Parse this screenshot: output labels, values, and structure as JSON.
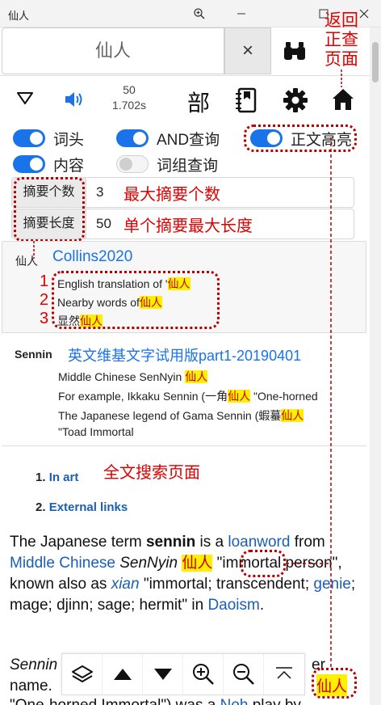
{
  "window": {
    "title": "仙人"
  },
  "search": {
    "value": "仙人",
    "clear_label": "×"
  },
  "toolbar": {
    "count": "50",
    "time": "1.702s",
    "radical_label": "部"
  },
  "options": {
    "headword": "词头",
    "and_query": "AND查询",
    "body_highlight": "正文高亮",
    "content": "内容",
    "phrase_query": "词组查询",
    "max_summary_label": "摘要个数",
    "max_summary_value": "3",
    "summary_length_label": "摘要长度",
    "summary_length_value": "50"
  },
  "annotations": {
    "return_to_lookup": [
      "返回",
      "正查",
      "页面"
    ],
    "max_summary": "最大摘要个数",
    "max_summary_length": "单个摘要最大长度",
    "fulltext_page": "全文搜索页面",
    "num1": "1",
    "num2": "2",
    "num3": "3",
    "bottom_highlight": "仙人"
  },
  "results": [
    {
      "word": "仙人",
      "dict": "Collins2020",
      "lines": [
        {
          "pre": "English translation of '",
          "hl": "仙人",
          "post": ""
        },
        {
          "pre": "Nearby words of",
          "hl": "仙人",
          "post": ""
        },
        {
          "pre": "显然",
          "hl": "仙人",
          "post": ""
        }
      ]
    },
    {
      "word": "Sennin",
      "dict": "英文维基文字试用版part1-20190401",
      "lines": [
        {
          "pre": "Middle Chinese SenNyin ",
          "hl": "仙人",
          "post": ""
        },
        {
          "pre": "For example, Ikkaku Sennin (一角",
          "hl": "仙人",
          "post": " \"One-horned"
        },
        {
          "pre": "The Japanese legend of Gama Sennin (蝦蟇",
          "hl": "仙人",
          "post": ""
        },
        {
          "pre": "\"Toad Immortal",
          "hl": "",
          "post": ""
        }
      ]
    }
  ],
  "fulltext": {
    "toc": [
      {
        "num": "1.",
        "label": "In art"
      },
      {
        "num": "2.",
        "label": "External links"
      }
    ],
    "p1": {
      "a": "The Japanese term ",
      "b": "sennin",
      "c": " is a ",
      "d": "loanword",
      "e": " from ",
      "f": "Middle Chinese",
      "g": " ",
      "h": "SenNyin",
      "i": " ",
      "j": "仙人",
      "k": " \"immortal person\", known also as ",
      "l": "xian",
      "m": " \"immortal; transcendent; ",
      "n": "genie",
      "o": "; mage; djinn; sage; hermit\" in ",
      "p": "Daoism",
      "q": "."
    },
    "p2": {
      "a": "Sennin",
      "b": "er",
      "c": "name.",
      "d": "\"One-horned Immortal\") was a ",
      "e": "Noh",
      "f": " play by"
    }
  },
  "colors": {
    "accent": "#1a73e8",
    "annotation": "#e00000",
    "highlight_bg": "#ffef00",
    "link": "#1a5fb4"
  },
  "icons": [
    "triangle-down-icon",
    "speaker-icon",
    "book-icon",
    "gear-icon",
    "home-icon",
    "binoculars-icon",
    "layers-icon",
    "arrow-up-icon",
    "arrow-down-icon",
    "zoom-in-icon",
    "zoom-out-icon",
    "scroll-top-icon"
  ]
}
